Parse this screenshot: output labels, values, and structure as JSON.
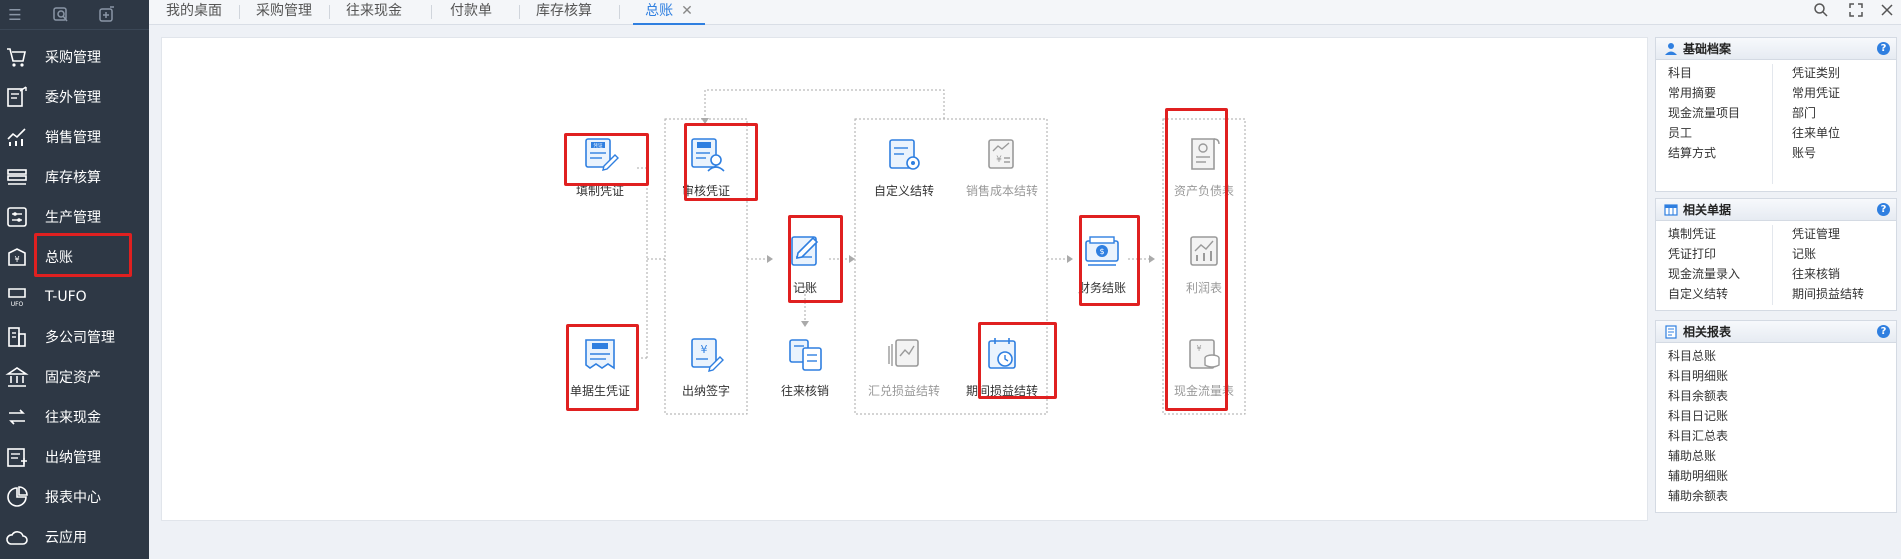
{
  "sidebar": {
    "items": [
      {
        "label": "采购管理",
        "icon": "cart-icon"
      },
      {
        "label": "委外管理",
        "icon": "outsource-icon"
      },
      {
        "label": "销售管理",
        "icon": "sales-chart-icon"
      },
      {
        "label": "库存核算",
        "icon": "inventory-icon"
      },
      {
        "label": "生产管理",
        "icon": "production-icon"
      },
      {
        "label": "总账",
        "icon": "ledger-icon"
      },
      {
        "label": "T-UFO",
        "icon": "ufo-icon"
      },
      {
        "label": "多公司管理",
        "icon": "building-icon"
      },
      {
        "label": "固定资产",
        "icon": "bank-icon"
      },
      {
        "label": "往来现金",
        "icon": "exchange-icon"
      },
      {
        "label": "出纳管理",
        "icon": "cashier-icon"
      },
      {
        "label": "报表中心",
        "icon": "pie-icon"
      },
      {
        "label": "云应用",
        "icon": "cloud-icon"
      }
    ]
  },
  "tabs": [
    {
      "label": "我的桌面"
    },
    {
      "label": "采购管理"
    },
    {
      "label": "往来现金"
    },
    {
      "label": "付款单"
    },
    {
      "label": "库存核算"
    },
    {
      "label": "总账",
      "active": true,
      "close": "✕"
    }
  ],
  "flow": {
    "nodes": {
      "tianzhi": "填制凭证",
      "danju": "单据生凭证",
      "shenhe": "审核凭证",
      "chuna": "出纳签字",
      "jizhang": "记账",
      "wanglai": "往来核销",
      "zidingyi": "自定义结转",
      "xiaoshou": "销售成本结转",
      "huidui": "汇兑损益结转",
      "qijian": "期间损益结转",
      "caiwu": "财务结账",
      "zichan": "资产负债表",
      "lirun": "利润表",
      "xianjin": "现金流量表"
    },
    "icon_badge": "凭证"
  },
  "panels": [
    {
      "title": "基础档案",
      "left": [
        "科目",
        "常用摘要",
        "现金流量项目",
        "员工",
        "结算方式"
      ],
      "right": [
        "凭证类别",
        "常用凭证",
        "部门",
        "往来单位",
        "账号"
      ]
    },
    {
      "title": "相关单据",
      "left": [
        "填制凭证",
        "凭证打印",
        "现金流量录入",
        "自定义结转"
      ],
      "right": [
        "凭证管理",
        "记账",
        "往来核销",
        "期间损益结转"
      ]
    },
    {
      "title": "相关报表",
      "left": [
        "科目总账",
        "科目明细账",
        "科目余额表",
        "科目日记账",
        "科目汇总表",
        "辅助总账",
        "辅助明细账",
        "辅助余额表"
      ],
      "right": []
    }
  ],
  "help_glyph": "?",
  "colors": {
    "sidebar_bg": "#2e3845",
    "accent": "#2f7fe0",
    "highlight": "#e02020"
  }
}
